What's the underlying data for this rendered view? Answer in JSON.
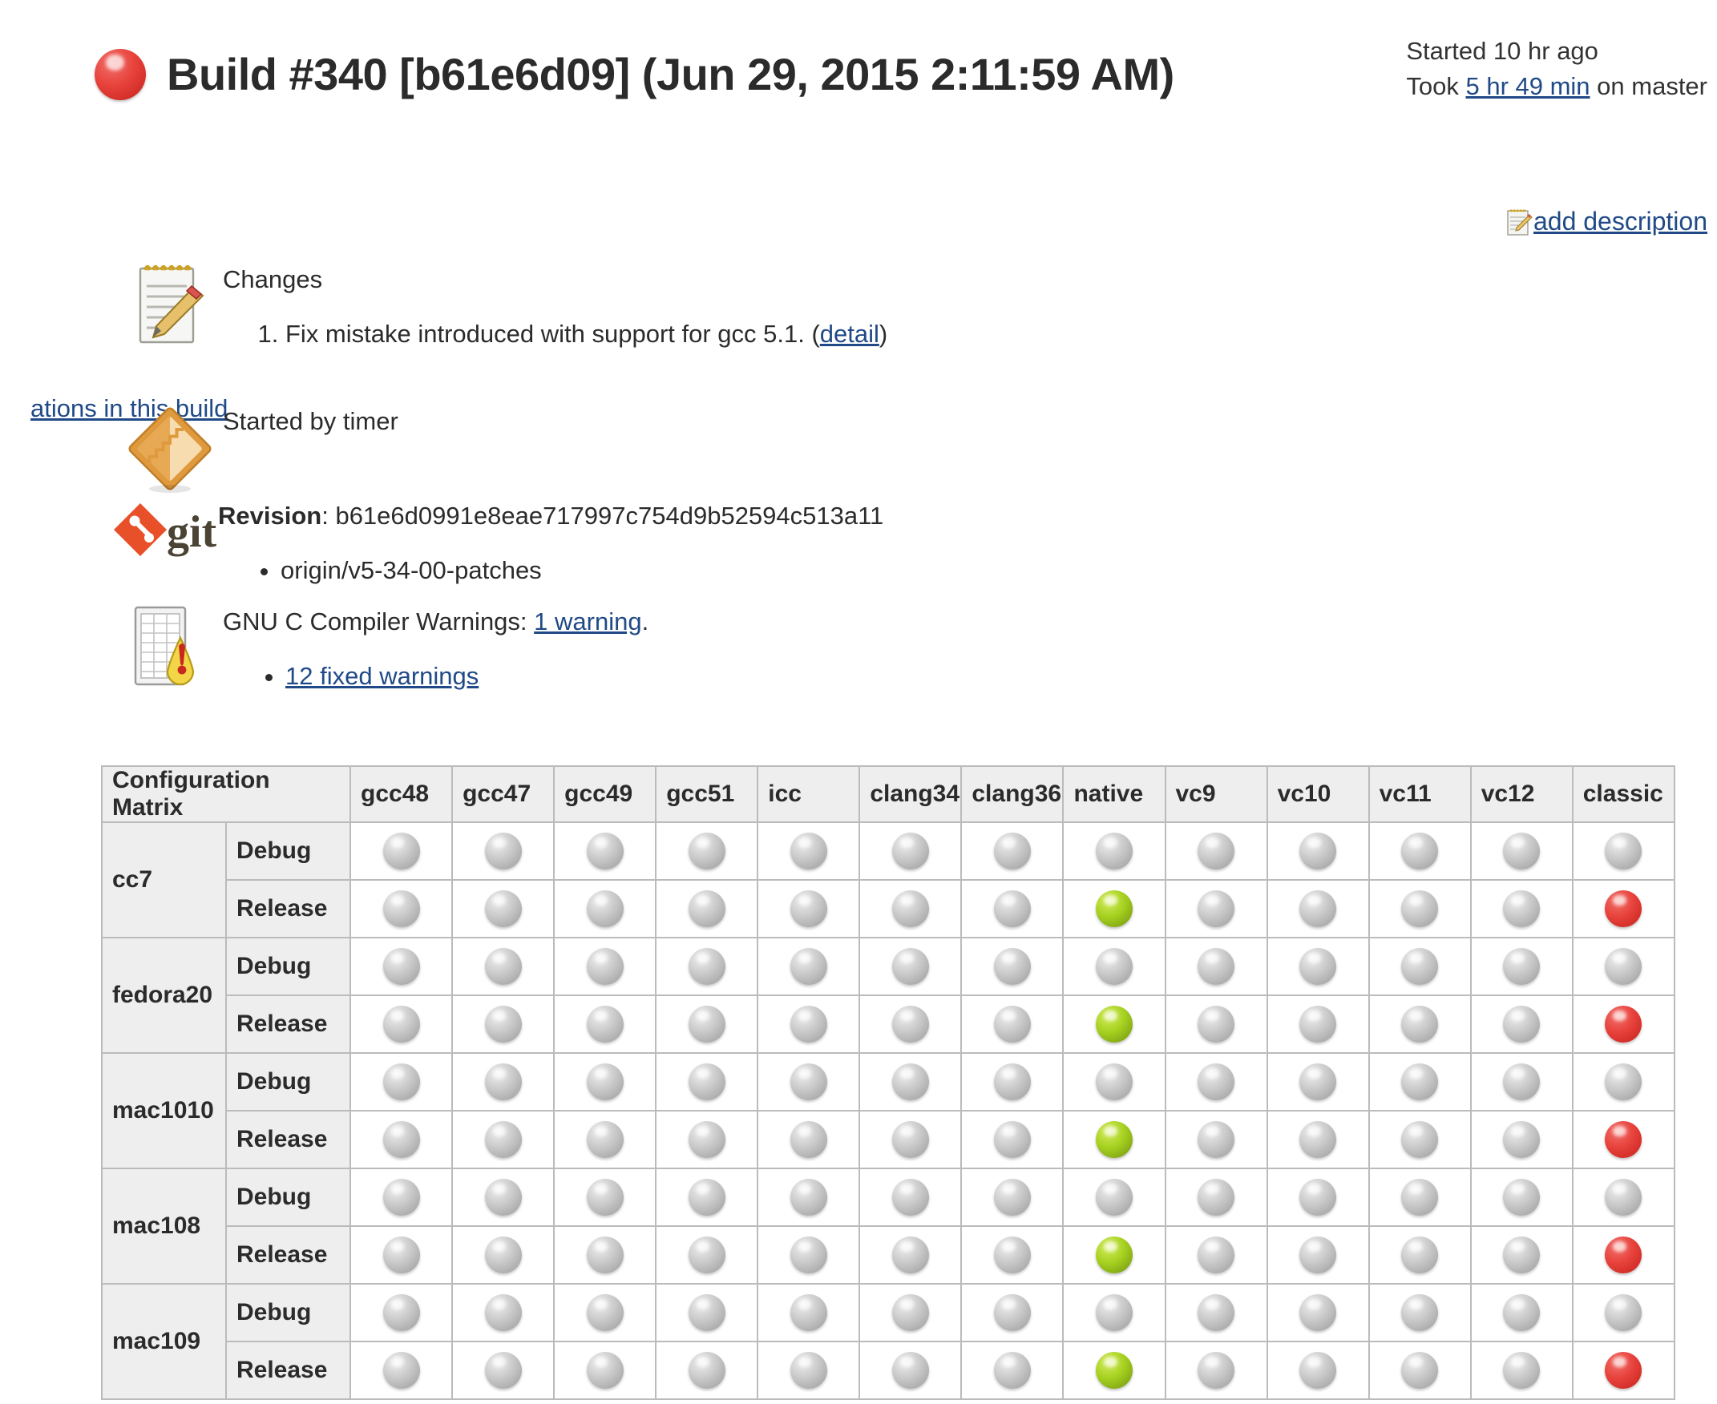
{
  "header": {
    "status_ball": "red",
    "title": "Build #340 [b61e6d09] (Jun 29, 2015 2:11:59 AM)",
    "started": "Started 10 hr ago",
    "took_prefix": "Took ",
    "took_link": "5 hr 49 min",
    "took_suffix": " on master"
  },
  "description": {
    "icon": "notepad-pencil-icon",
    "label": "add description"
  },
  "truncated_link": "ations in this build",
  "changes": {
    "icon": "notepad-pencil-icon",
    "heading": "Changes",
    "items": [
      {
        "text_prefix": "Fix mistake introduced with support for gcc 5.1. (",
        "link": "detail",
        "text_suffix": ")"
      }
    ]
  },
  "cause": {
    "icon": "orange-diamond-clock-icon",
    "text": "Started by timer"
  },
  "git": {
    "icon": "git-logo-icon",
    "revision_label": "Revision",
    "revision_sep": ": ",
    "revision_sha": "b61e6d0991e8eae717997c754d9b52594c513a11",
    "branches": [
      "origin/v5-34-00-patches"
    ]
  },
  "warnings": {
    "icon": "warnings-report-icon",
    "text_prefix": "GNU C Compiler Warnings: ",
    "count_link": "1 warning",
    "text_suffix": ".",
    "items": [
      {
        "link": "12 fixed warnings"
      }
    ]
  },
  "matrix": {
    "axis_label": "Configuration Matrix",
    "columns": [
      "gcc48",
      "gcc47",
      "gcc49",
      "gcc51",
      "icc",
      "clang34",
      "clang36",
      "native",
      "vc9",
      "vc10",
      "vc11",
      "vc12",
      "classic"
    ],
    "rows": [
      {
        "label": "cc7",
        "variants": [
          {
            "name": "Debug",
            "states": [
              "grey",
              "grey",
              "grey",
              "grey",
              "grey",
              "grey",
              "grey",
              "grey",
              "grey",
              "grey",
              "grey",
              "grey",
              "grey"
            ]
          },
          {
            "name": "Release",
            "states": [
              "grey",
              "grey",
              "grey",
              "grey",
              "grey",
              "grey",
              "grey",
              "green",
              "grey",
              "grey",
              "grey",
              "grey",
              "red"
            ]
          }
        ]
      },
      {
        "label": "fedora20",
        "variants": [
          {
            "name": "Debug",
            "states": [
              "grey",
              "grey",
              "grey",
              "grey",
              "grey",
              "grey",
              "grey",
              "grey",
              "grey",
              "grey",
              "grey",
              "grey",
              "grey"
            ]
          },
          {
            "name": "Release",
            "states": [
              "grey",
              "grey",
              "grey",
              "grey",
              "grey",
              "grey",
              "grey",
              "green",
              "grey",
              "grey",
              "grey",
              "grey",
              "red"
            ]
          }
        ]
      },
      {
        "label": "mac1010",
        "variants": [
          {
            "name": "Debug",
            "states": [
              "grey",
              "grey",
              "grey",
              "grey",
              "grey",
              "grey",
              "grey",
              "grey",
              "grey",
              "grey",
              "grey",
              "grey",
              "grey"
            ]
          },
          {
            "name": "Release",
            "states": [
              "grey",
              "grey",
              "grey",
              "grey",
              "grey",
              "grey",
              "grey",
              "green",
              "grey",
              "grey",
              "grey",
              "grey",
              "red"
            ]
          }
        ]
      },
      {
        "label": "mac108",
        "variants": [
          {
            "name": "Debug",
            "states": [
              "grey",
              "grey",
              "grey",
              "grey",
              "grey",
              "grey",
              "grey",
              "grey",
              "grey",
              "grey",
              "grey",
              "grey",
              "grey"
            ]
          },
          {
            "name": "Release",
            "states": [
              "grey",
              "grey",
              "grey",
              "grey",
              "grey",
              "grey",
              "grey",
              "green",
              "grey",
              "grey",
              "grey",
              "grey",
              "red"
            ]
          }
        ]
      },
      {
        "label": "mac109",
        "variants": [
          {
            "name": "Debug",
            "states": [
              "grey",
              "grey",
              "grey",
              "grey",
              "grey",
              "grey",
              "grey",
              "grey",
              "grey",
              "grey",
              "grey",
              "grey",
              "grey"
            ]
          },
          {
            "name": "Release",
            "states": [
              "grey",
              "grey",
              "grey",
              "grey",
              "grey",
              "grey",
              "grey",
              "green",
              "grey",
              "grey",
              "grey",
              "grey",
              "red"
            ]
          }
        ]
      }
    ]
  },
  "colors": {
    "link": "#204a87",
    "success": "#a6d120",
    "failure": "#e8423c",
    "disabled": "#c9c9c9",
    "header_bg": "#eeeeee",
    "border": "#bbbbbb"
  }
}
